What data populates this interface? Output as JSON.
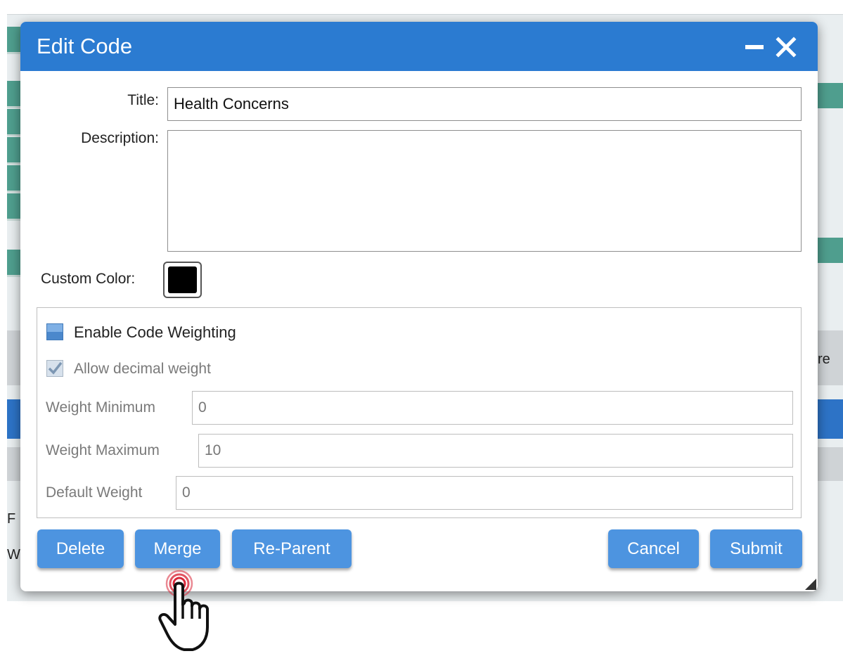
{
  "dialog": {
    "title": "Edit Code",
    "fields": {
      "title_label": "Title:",
      "title_value": "Health Concerns",
      "description_label": "Description:",
      "description_value": "",
      "custom_color_label": "Custom Color:",
      "custom_color": "#000000"
    },
    "weighting": {
      "enable_label": "Enable Code Weighting",
      "enable_checked": false,
      "decimal_label": "Allow decimal weight",
      "decimal_checked": true,
      "min_label": "Weight Minimum",
      "min_value": "0",
      "max_label": "Weight Maximum",
      "max_value": "10",
      "default_label": "Default Weight",
      "default_value": "0"
    },
    "buttons": {
      "delete": "Delete",
      "merge": "Merge",
      "reparent": "Re-Parent",
      "cancel": "Cancel",
      "submit": "Submit"
    }
  },
  "background": {
    "fragment_1": "F",
    "fragment_2": "W",
    "fragment_3": "re"
  },
  "colors": {
    "titlebar": "#2b7bd1",
    "button": "#4d94e0",
    "click_ripple": "#d9283a"
  },
  "icons": [
    "minimize-icon",
    "close-icon",
    "resize-grip-icon",
    "hand-pointer-cursor-icon"
  ]
}
